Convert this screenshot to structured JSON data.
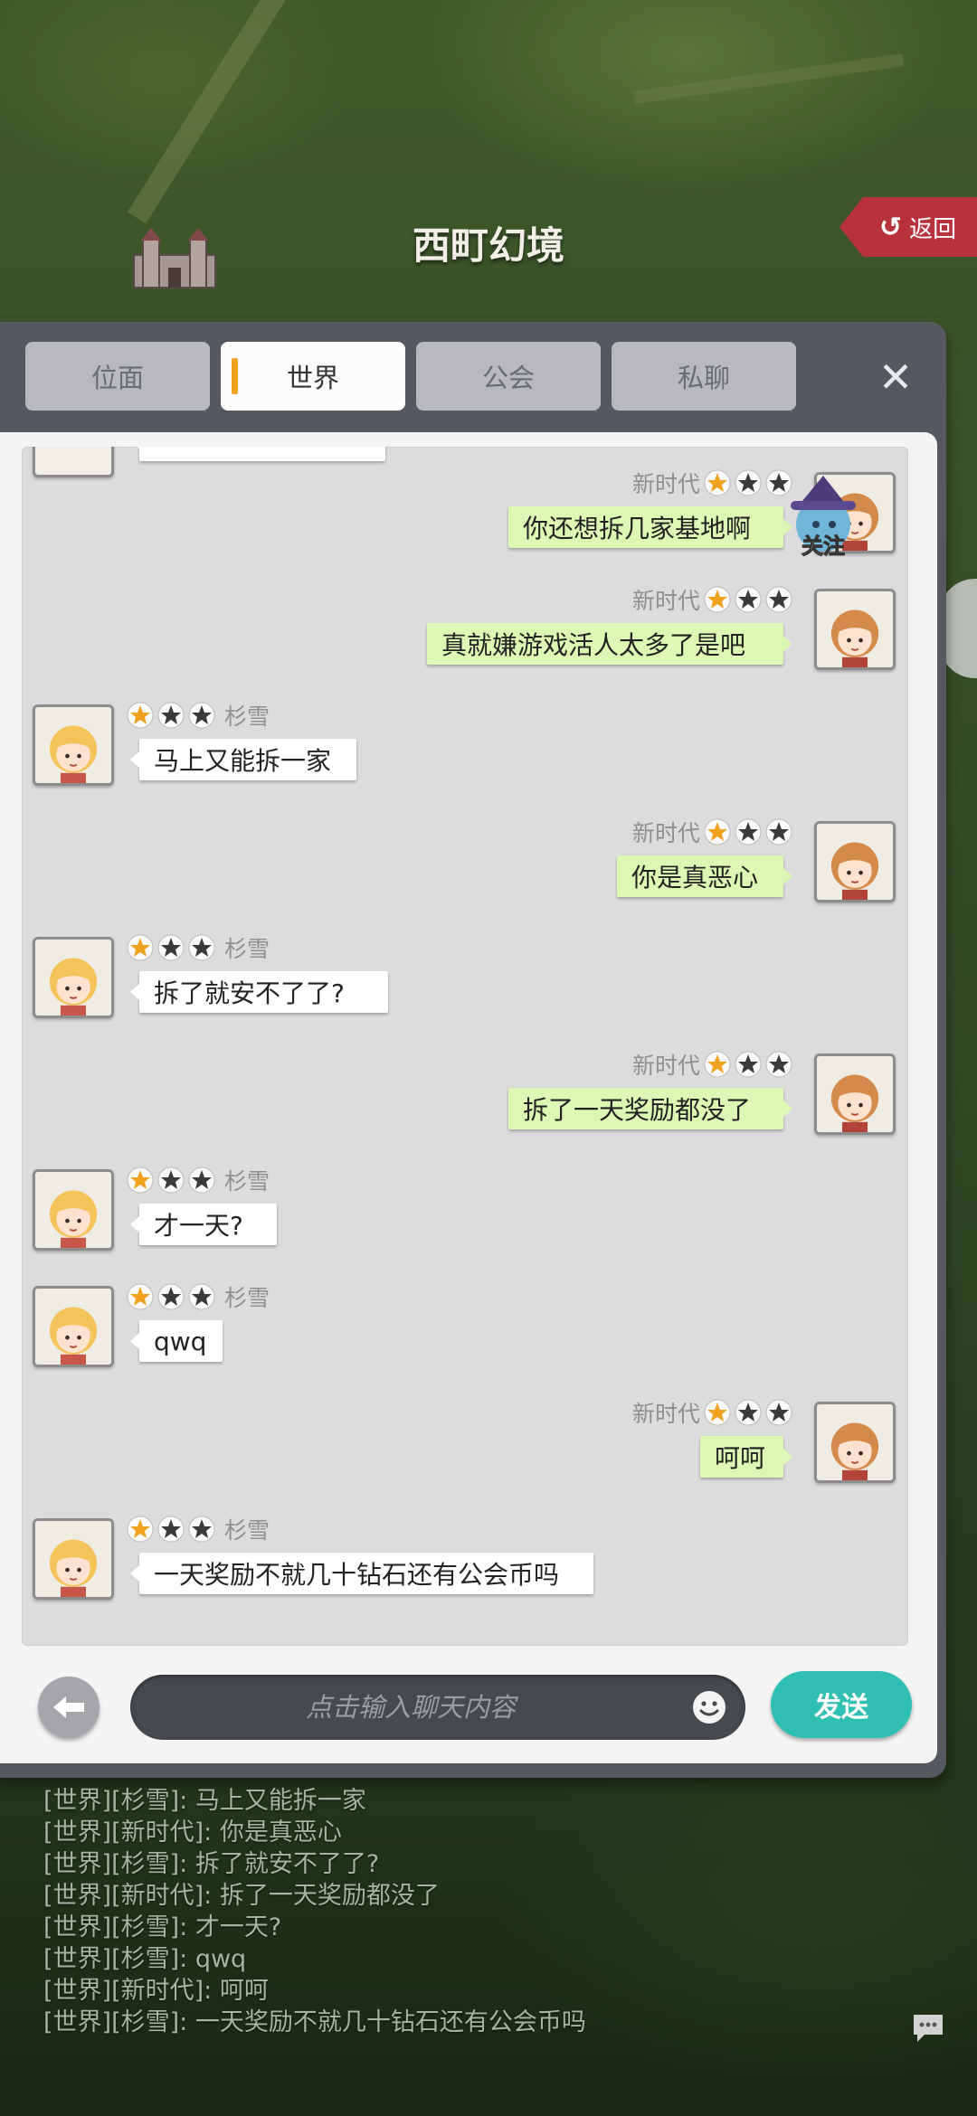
{
  "map": {
    "region_title": "西町幻境",
    "return_label": "返回"
  },
  "tabs": [
    {
      "label": "位面",
      "active": false
    },
    {
      "label": "世界",
      "active": true
    },
    {
      "label": "公会",
      "active": false
    },
    {
      "label": "私聊",
      "active": false
    }
  ],
  "follow_badge": "关注",
  "messages": [
    {
      "side": "right",
      "name": "新时代",
      "stars": 1,
      "text": "你还想拆几家基地啊"
    },
    {
      "side": "right",
      "name": "新时代",
      "stars": 1,
      "text": "真就嫌游戏活人太多了是吧"
    },
    {
      "side": "left",
      "name": "杉雪",
      "stars": 1,
      "text": "马上又能拆一家"
    },
    {
      "side": "right",
      "name": "新时代",
      "stars": 1,
      "text": "你是真恶心"
    },
    {
      "side": "left",
      "name": "杉雪",
      "stars": 1,
      "text": "拆了就安不了了?"
    },
    {
      "side": "right",
      "name": "新时代",
      "stars": 1,
      "text": "拆了一天奖励都没了"
    },
    {
      "side": "left",
      "name": "杉雪",
      "stars": 1,
      "text": "才一天?"
    },
    {
      "side": "left",
      "name": "杉雪",
      "stars": 1,
      "text": "qwq"
    },
    {
      "side": "right",
      "name": "新时代",
      "stars": 1,
      "text": "呵呵"
    },
    {
      "side": "left",
      "name": "杉雪",
      "stars": 1,
      "text": "一天奖励不就几十钻石还有公会币吗"
    }
  ],
  "input": {
    "placeholder": "点击输入聊天内容",
    "send_label": "发送"
  },
  "log": [
    "[世界][杉雪]: 马上又能拆一家",
    "[世界][新时代]: 你是真恶心",
    "[世界][杉雪]: 拆了就安不了了?",
    "[世界][新时代]: 拆了一天奖励都没了",
    "[世界][杉雪]: 才一天?",
    "[世界][杉雪]: qwq",
    "[世界][新时代]: 呵呵",
    "[世界][杉雪]: 一天奖励不就几十钻石还有公会币吗"
  ],
  "colors": {
    "star_filled": "#f0a21e",
    "star_empty": "#3a3a3a",
    "bubble_right": "#ddf7b4",
    "send_button": "#2fbfb3",
    "active_tab_marker": "#f0a21e"
  }
}
